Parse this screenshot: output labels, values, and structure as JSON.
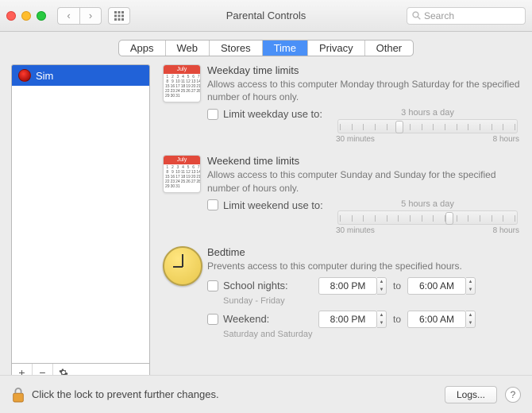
{
  "window": {
    "title": "Parental Controls",
    "search_placeholder": "Search"
  },
  "tabs": {
    "apps": "Apps",
    "web": "Web",
    "stores": "Stores",
    "time": "Time",
    "privacy": "Privacy",
    "other": "Other",
    "active": "time"
  },
  "sidebar": {
    "users": [
      {
        "name": "Sim"
      }
    ]
  },
  "weekday": {
    "month": "July",
    "title": "Weekday time limits",
    "desc": "Allows access to this computer Monday through Saturday for the specified number of hours only.",
    "checkbox_label": "Limit weekday use to:",
    "slider_caption": "3 hours a day",
    "slider_min": "30 minutes",
    "slider_max": "8 hours",
    "slider_pos_pct": 32
  },
  "weekend": {
    "month": "July",
    "title": "Weekend time limits",
    "desc": "Allows access to this computer Sunday and Sunday for the specified number of hours only.",
    "checkbox_label": "Limit weekend use to:",
    "slider_caption": "5 hours a day",
    "slider_min": "30 minutes",
    "slider_max": "8 hours",
    "slider_pos_pct": 60
  },
  "bedtime": {
    "title": "Bedtime",
    "desc": "Prevents access to this computer during the specified hours.",
    "school": {
      "label": "School nights:",
      "sub": "Sunday - Friday",
      "from": "8:00 PM",
      "to_label": "to",
      "to": "6:00 AM"
    },
    "weekend": {
      "label": "Weekend:",
      "sub": "Saturday and Saturday",
      "from": "8:00 PM",
      "to_label": "to",
      "to": "6:00 AM"
    }
  },
  "footer": {
    "lock_text": "Click the lock to prevent further changes.",
    "logs": "Logs..."
  }
}
